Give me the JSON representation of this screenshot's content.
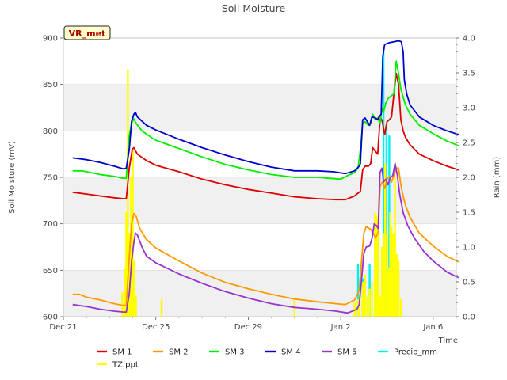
{
  "chart_data": {
    "type": "line",
    "title": "Soil Moisture",
    "badge": "VR_met",
    "xlabel": "Time",
    "ylabel": "Soil Moisture (mV)",
    "y2label": "Rain (mm)",
    "xlim": [
      0,
      17
    ],
    "ylim": [
      600,
      900
    ],
    "y2lim": [
      0.0,
      4.0
    ],
    "x_ticks": [
      {
        "x": 0,
        "label": "Dec 21"
      },
      {
        "x": 4,
        "label": "Dec 25"
      },
      {
        "x": 8,
        "label": "Dec 29"
      },
      {
        "x": 12,
        "label": "Jan 2"
      },
      {
        "x": 16,
        "label": "Jan 6"
      }
    ],
    "y_ticks": [
      "600",
      "650",
      "700",
      "750",
      "800",
      "850",
      "900"
    ],
    "y2_ticks": [
      "0.0",
      "0.5",
      "1.0",
      "1.5",
      "2.0",
      "2.5",
      "3.0",
      "3.5",
      "4.0"
    ],
    "grid": "horizontal bands",
    "legend_position": "bottom",
    "series": [
      {
        "name": "SM 1",
        "axis": "left",
        "color": "#dd0000",
        "points": [
          [
            0.4,
            734
          ],
          [
            1.0,
            732
          ],
          [
            1.6,
            730
          ],
          [
            2.2,
            728
          ],
          [
            2.6,
            727
          ],
          [
            2.72,
            727
          ],
          [
            2.85,
            760
          ],
          [
            2.98,
            780
          ],
          [
            3.05,
            782
          ],
          [
            3.2,
            775
          ],
          [
            3.6,
            768
          ],
          [
            4.0,
            763
          ],
          [
            5.0,
            756
          ],
          [
            6.0,
            748
          ],
          [
            7.0,
            742
          ],
          [
            8.0,
            737
          ],
          [
            9.0,
            733
          ],
          [
            10.0,
            729
          ],
          [
            11.0,
            727
          ],
          [
            11.8,
            726
          ],
          [
            12.2,
            726
          ],
          [
            12.6,
            730
          ],
          [
            12.85,
            735
          ],
          [
            12.95,
            758
          ],
          [
            13.05,
            762
          ],
          [
            13.2,
            762
          ],
          [
            13.3,
            765
          ],
          [
            13.38,
            782
          ],
          [
            13.5,
            778
          ],
          [
            13.6,
            775
          ],
          [
            13.68,
            805
          ],
          [
            13.72,
            815
          ],
          [
            13.8,
            810
          ],
          [
            13.9,
            796
          ],
          [
            14.0,
            810
          ],
          [
            14.1,
            812
          ],
          [
            14.2,
            815
          ],
          [
            14.3,
            840
          ],
          [
            14.4,
            862
          ],
          [
            14.5,
            850
          ],
          [
            14.6,
            812
          ],
          [
            14.7,
            800
          ],
          [
            14.8,
            793
          ],
          [
            15.0,
            785
          ],
          [
            15.4,
            775
          ],
          [
            16.0,
            768
          ],
          [
            16.6,
            762
          ],
          [
            17.1,
            758
          ]
        ]
      },
      {
        "name": "SM 2",
        "axis": "left",
        "color": "#ff9900",
        "points": [
          [
            0.4,
            624
          ],
          [
            0.7,
            624
          ],
          [
            1.0,
            621
          ],
          [
            1.6,
            618
          ],
          [
            2.2,
            614
          ],
          [
            2.6,
            612
          ],
          [
            2.72,
            612
          ],
          [
            2.85,
            665
          ],
          [
            2.95,
            700
          ],
          [
            3.05,
            711
          ],
          [
            3.15,
            708
          ],
          [
            3.3,
            695
          ],
          [
            3.6,
            683
          ],
          [
            4.0,
            674
          ],
          [
            5.0,
            660
          ],
          [
            6.0,
            647
          ],
          [
            7.0,
            637
          ],
          [
            8.0,
            630
          ],
          [
            9.0,
            624
          ],
          [
            10.0,
            619
          ],
          [
            11.0,
            616
          ],
          [
            11.8,
            614
          ],
          [
            12.2,
            613
          ],
          [
            12.6,
            618
          ],
          [
            12.8,
            628
          ],
          [
            12.9,
            660
          ],
          [
            13.0,
            690
          ],
          [
            13.1,
            697
          ],
          [
            13.3,
            694
          ],
          [
            13.4,
            690
          ],
          [
            13.5,
            685
          ],
          [
            13.62,
            690
          ],
          [
            13.7,
            740
          ],
          [
            13.8,
            745
          ],
          [
            13.9,
            738
          ],
          [
            14.0,
            748
          ],
          [
            14.1,
            751
          ],
          [
            14.2,
            745
          ],
          [
            14.3,
            752
          ],
          [
            14.4,
            760
          ],
          [
            14.5,
            760
          ],
          [
            14.6,
            742
          ],
          [
            14.7,
            730
          ],
          [
            14.8,
            720
          ],
          [
            15.0,
            707
          ],
          [
            15.4,
            690
          ],
          [
            16.0,
            676
          ],
          [
            16.6,
            665
          ],
          [
            17.1,
            659
          ]
        ]
      },
      {
        "name": "SM 3",
        "axis": "left",
        "color": "#00ee00",
        "points": [
          [
            0.4,
            757
          ],
          [
            0.8,
            757
          ],
          [
            1.2,
            755
          ],
          [
            1.6,
            753
          ],
          [
            2.2,
            751
          ],
          [
            2.6,
            749
          ],
          [
            2.72,
            749
          ],
          [
            2.85,
            795
          ],
          [
            2.95,
            808
          ],
          [
            3.05,
            813
          ],
          [
            3.15,
            808
          ],
          [
            3.4,
            800
          ],
          [
            3.8,
            793
          ],
          [
            4.0,
            790
          ],
          [
            5.0,
            781
          ],
          [
            6.0,
            772
          ],
          [
            7.0,
            764
          ],
          [
            8.0,
            758
          ],
          [
            9.0,
            753
          ],
          [
            10.0,
            750
          ],
          [
            11.0,
            750
          ],
          [
            11.5,
            749
          ],
          [
            12.0,
            748
          ],
          [
            12.3,
            752
          ],
          [
            12.6,
            755
          ],
          [
            12.75,
            760
          ],
          [
            12.85,
            780
          ],
          [
            12.95,
            808
          ],
          [
            13.05,
            810
          ],
          [
            13.2,
            806
          ],
          [
            13.3,
            808
          ],
          [
            13.38,
            818
          ],
          [
            13.5,
            812
          ],
          [
            13.6,
            814
          ],
          [
            13.7,
            808
          ],
          [
            13.78,
            824
          ],
          [
            13.85,
            820
          ],
          [
            13.95,
            830
          ],
          [
            14.05,
            835
          ],
          [
            14.2,
            838
          ],
          [
            14.3,
            840
          ],
          [
            14.35,
            858
          ],
          [
            14.4,
            875
          ],
          [
            14.5,
            862
          ],
          [
            14.6,
            845
          ],
          [
            14.8,
            828
          ],
          [
            15.0,
            818
          ],
          [
            15.4,
            806
          ],
          [
            16.0,
            797
          ],
          [
            16.6,
            789
          ],
          [
            17.1,
            784
          ]
        ]
      },
      {
        "name": "SM 4",
        "axis": "left",
        "color": "#0000cc",
        "points": [
          [
            0.4,
            771
          ],
          [
            1.0,
            769
          ],
          [
            1.6,
            766
          ],
          [
            2.2,
            762
          ],
          [
            2.6,
            759
          ],
          [
            2.72,
            760
          ],
          [
            2.85,
            780
          ],
          [
            2.95,
            810
          ],
          [
            3.05,
            818
          ],
          [
            3.12,
            820
          ],
          [
            3.2,
            815
          ],
          [
            3.6,
            806
          ],
          [
            4.0,
            801
          ],
          [
            5.0,
            791
          ],
          [
            6.0,
            782
          ],
          [
            7.0,
            774
          ],
          [
            8.0,
            767
          ],
          [
            9.0,
            761
          ],
          [
            10.0,
            757
          ],
          [
            11.0,
            757
          ],
          [
            11.7,
            756
          ],
          [
            12.2,
            754
          ],
          [
            12.6,
            757
          ],
          [
            12.8,
            762
          ],
          [
            12.85,
            765
          ],
          [
            12.95,
            812
          ],
          [
            13.05,
            814
          ],
          [
            13.15,
            810
          ],
          [
            13.25,
            806
          ],
          [
            13.35,
            815
          ],
          [
            13.5,
            814
          ],
          [
            13.6,
            812
          ],
          [
            13.65,
            815
          ],
          [
            13.75,
            818
          ],
          [
            13.82,
            880
          ],
          [
            13.9,
            893
          ],
          [
            14.1,
            895
          ],
          [
            14.3,
            896
          ],
          [
            14.5,
            897
          ],
          [
            14.62,
            896
          ],
          [
            14.7,
            885
          ],
          [
            14.75,
            855
          ],
          [
            14.85,
            840
          ],
          [
            15.0,
            828
          ],
          [
            15.4,
            815
          ],
          [
            16.0,
            806
          ],
          [
            16.6,
            800
          ],
          [
            17.1,
            796
          ]
        ]
      },
      {
        "name": "SM 5",
        "axis": "left",
        "color": "#9933cc",
        "points": [
          [
            0.4,
            613
          ],
          [
            1.0,
            611
          ],
          [
            1.6,
            608
          ],
          [
            2.2,
            606
          ],
          [
            2.6,
            605
          ],
          [
            2.72,
            605
          ],
          [
            2.85,
            625
          ],
          [
            2.95,
            660
          ],
          [
            3.05,
            680
          ],
          [
            3.12,
            690
          ],
          [
            3.2,
            688
          ],
          [
            3.4,
            675
          ],
          [
            3.6,
            665
          ],
          [
            4.0,
            658
          ],
          [
            5.0,
            646
          ],
          [
            6.0,
            636
          ],
          [
            7.0,
            627
          ],
          [
            8.0,
            620
          ],
          [
            9.0,
            614
          ],
          [
            10.0,
            610
          ],
          [
            11.0,
            608
          ],
          [
            11.8,
            606
          ],
          [
            12.3,
            604
          ],
          [
            12.7,
            608
          ],
          [
            12.8,
            613
          ],
          [
            12.9,
            640
          ],
          [
            13.0,
            668
          ],
          [
            13.1,
            675
          ],
          [
            13.25,
            676
          ],
          [
            13.35,
            684
          ],
          [
            13.45,
            700
          ],
          [
            13.55,
            698
          ],
          [
            13.62,
            695
          ],
          [
            13.7,
            755
          ],
          [
            13.78,
            760
          ],
          [
            13.85,
            745
          ],
          [
            13.95,
            748
          ],
          [
            14.05,
            742
          ],
          [
            14.15,
            750
          ],
          [
            14.25,
            752
          ],
          [
            14.35,
            765
          ],
          [
            14.45,
            752
          ],
          [
            14.55,
            732
          ],
          [
            14.7,
            712
          ],
          [
            14.9,
            698
          ],
          [
            15.2,
            684
          ],
          [
            15.6,
            670
          ],
          [
            16.0,
            660
          ],
          [
            16.6,
            648
          ],
          [
            17.1,
            642
          ]
        ]
      }
    ],
    "bar_series": [
      {
        "name": "Precip_mm",
        "axis": "right",
        "color": "#00eeee",
        "bars": [
          [
            12.75,
            0.75
          ],
          [
            12.95,
            0.55
          ],
          [
            13.25,
            0.75
          ],
          [
            13.55,
            0.8
          ],
          [
            13.85,
            3.8
          ],
          [
            13.98,
            2.7
          ],
          [
            14.1,
            2.6
          ],
          [
            14.3,
            1.0
          ]
        ]
      },
      {
        "name": "TZ ppt",
        "axis": "right",
        "color": "#ffff00",
        "bars": [
          [
            2.55,
            0.35
          ],
          [
            2.65,
            0.7
          ],
          [
            2.72,
            1.5
          ],
          [
            2.79,
            3.55
          ],
          [
            2.86,
            1.2
          ],
          [
            2.93,
            2.0
          ],
          [
            3.0,
            2.4
          ],
          [
            3.07,
            0.8
          ],
          [
            3.14,
            0.3
          ],
          [
            4.25,
            0.25
          ],
          [
            10.0,
            0.25
          ],
          [
            12.6,
            0.2
          ],
          [
            12.75,
            0.25
          ],
          [
            12.82,
            0.3
          ],
          [
            12.95,
            0.5
          ],
          [
            13.05,
            0.6
          ],
          [
            13.15,
            0.3
          ],
          [
            13.25,
            0.4
          ],
          [
            13.35,
            0.5
          ],
          [
            13.48,
            1.5
          ],
          [
            13.55,
            1.45
          ],
          [
            13.62,
            1.2
          ],
          [
            13.7,
            0.3
          ],
          [
            13.78,
            1.0
          ],
          [
            13.85,
            1.2
          ],
          [
            13.92,
            2.2
          ],
          [
            14.0,
            1.2
          ],
          [
            14.07,
            0.7
          ],
          [
            14.14,
            1.5
          ],
          [
            14.2,
            1.3
          ],
          [
            14.28,
            1.2
          ],
          [
            14.35,
            2.0
          ],
          [
            14.42,
            0.9
          ],
          [
            14.5,
            0.8
          ],
          [
            14.6,
            0.25
          ]
        ]
      }
    ]
  }
}
